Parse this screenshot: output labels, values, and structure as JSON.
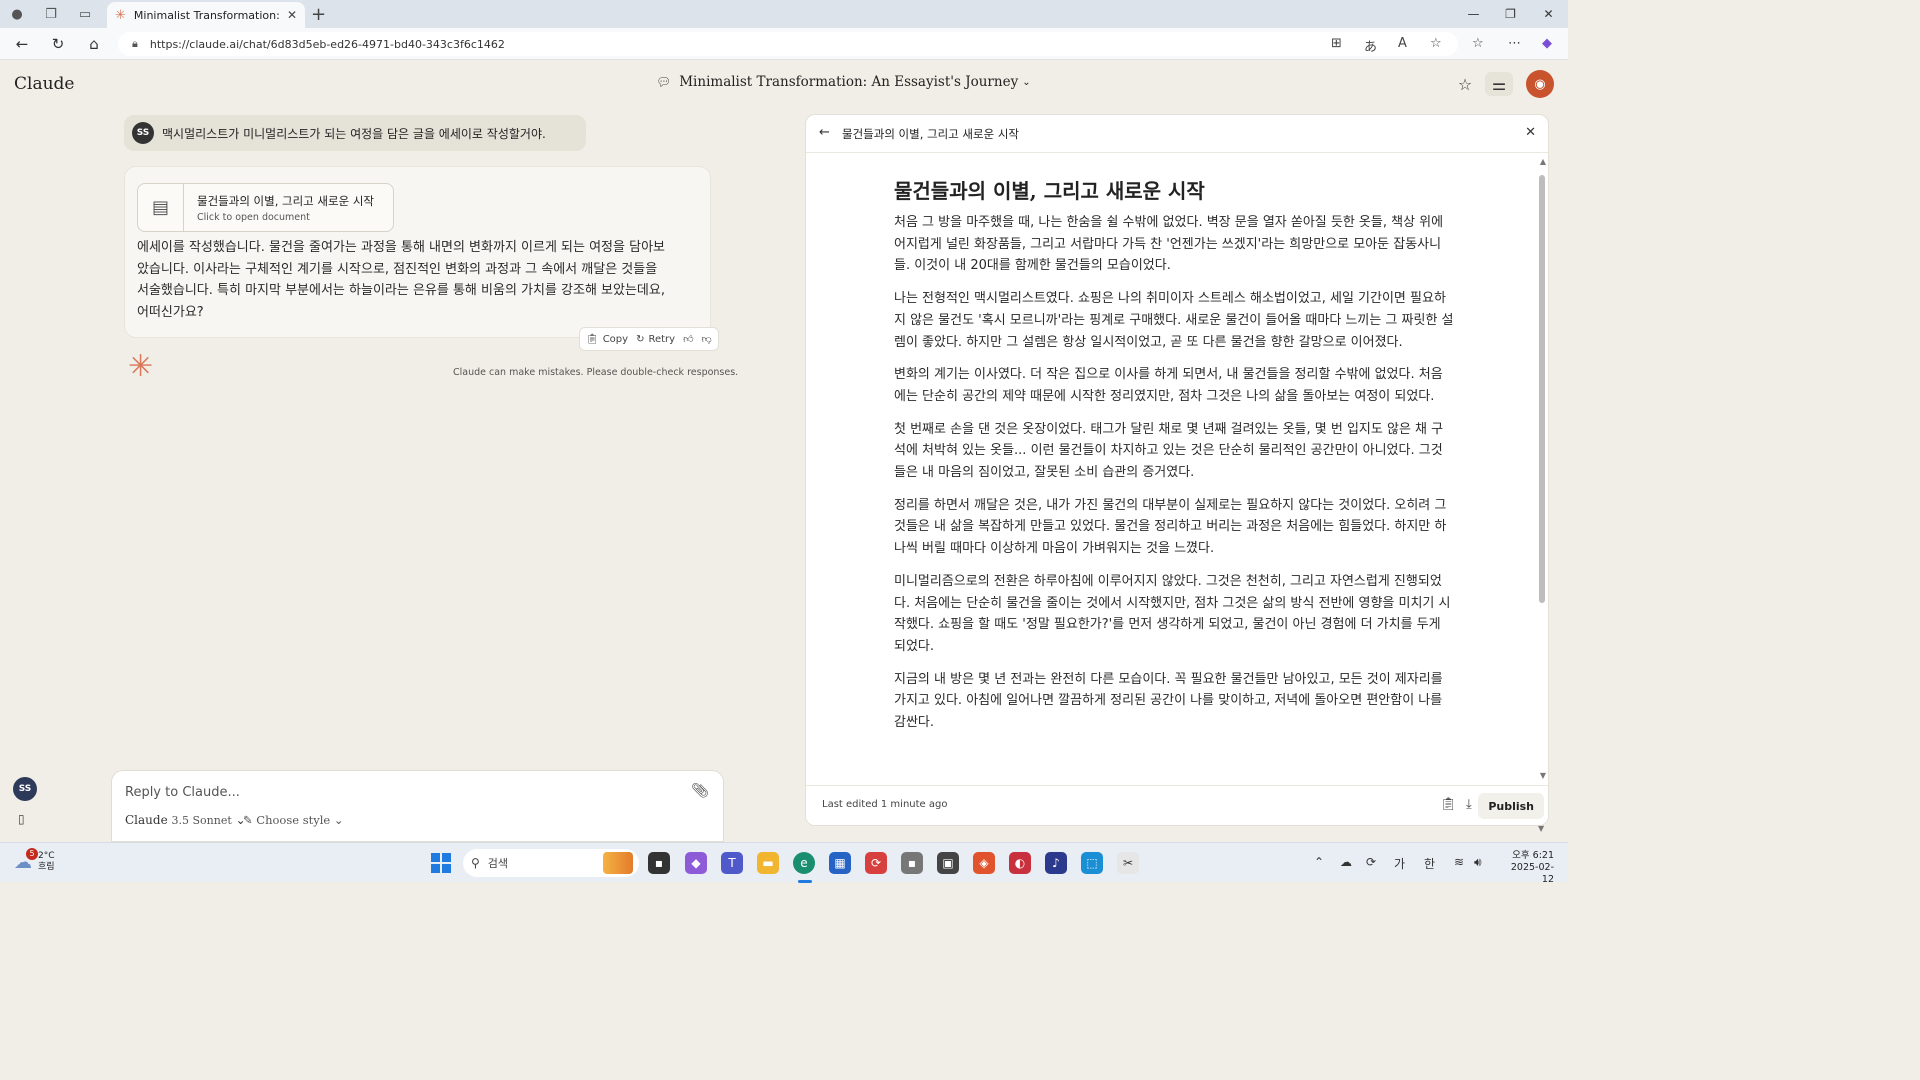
{
  "browser": {
    "tab_title": "Minimalist Transformation: An Ess",
    "url": "https://claude.ai/chat/6d83d5eb-ed26-4971-bd40-343c3f6c1462"
  },
  "header": {
    "logo": "Claude",
    "conversation_title": "Minimalist Transformation: An Essayist's Journey"
  },
  "chat": {
    "user_avatar": "SS",
    "user_message": "맥시멀리스트가 미니멀리스트가 되는 여정을 담은 글을 에세이로 작성할거야.",
    "doc_card_title": "물건들과의 이별, 그리고 새로운 시작",
    "doc_card_sub": "Click to open document",
    "assistant_text": "에세이를 작성했습니다. 물건을 줄여가는 과정을 통해 내면의 변화까지 이르게 되는 여정을 담아보았습니다. 이사라는 구체적인 계기를 시작으로, 점진적인 변화의 과정과 그 속에서 깨달은 것들을 서술했습니다. 특히 마지막 부분에서는 하늘이라는 은유를 통해 비움의 가치를 강조해 보았는데요, 어떠신가요?",
    "copy_label": "Copy",
    "retry_label": "Retry",
    "disclaimer": "Claude can make mistakes. Please double-check responses."
  },
  "input": {
    "placeholder": "Reply to Claude...",
    "model_name": "Claude",
    "model_version": "3.5 Sonnet",
    "style_label": "Choose style"
  },
  "sidebar": {
    "avatar": "SS"
  },
  "panel": {
    "header_title": "물건들과의 이별, 그리고 새로운 시작",
    "doc_title": "물건들과의 이별, 그리고 새로운 시작",
    "paragraphs": [
      "처음 그 방을 마주했을 때, 나는 한숨을 쉴 수밖에 없었다. 벽장 문을 열자 쏟아질 듯한 옷들, 책상 위에 어지럽게 널린 화장품들, 그리고 서랍마다 가득 찬 '언젠가는 쓰겠지'라는 희망만으로 모아둔 잡동사니들. 이것이 내 20대를 함께한 물건들의 모습이었다.",
      "나는 전형적인 맥시멀리스트였다. 쇼핑은 나의 취미이자 스트레스 해소법이었고, 세일 기간이면 필요하지 않은 물건도 '혹시 모르니까'라는 핑계로 구매했다. 새로운 물건이 들어올 때마다 느끼는 그 짜릿한 설렘이 좋았다. 하지만 그 설렘은 항상 일시적이었고, 곧 또 다른 물건을 향한 갈망으로 이어졌다.",
      "변화의 계기는 이사였다. 더 작은 집으로 이사를 하게 되면서, 내 물건들을 정리할 수밖에 없었다. 처음에는 단순히 공간의 제약 때문에 시작한 정리였지만, 점차 그것은 나의 삶을 돌아보는 여정이 되었다.",
      "첫 번째로 손을 댄 것은 옷장이었다. 태그가 달린 채로 몇 년째 걸려있는 옷들, 몇 번 입지도 않은 채 구석에 처박혀 있는 옷들... 이런 물건들이 차지하고 있는 것은 단순히 물리적인 공간만이 아니었다. 그것들은 내 마음의 짐이었고, 잘못된 소비 습관의 증거였다.",
      "정리를 하면서 깨달은 것은, 내가 가진 물건의 대부분이 실제로는 필요하지 않다는 것이었다. 오히려 그것들은 내 삶을 복잡하게 만들고 있었다. 물건을 정리하고 버리는 과정은 처음에는 힘들었다. 하지만 하나씩 버릴 때마다 이상하게 마음이 가벼워지는 것을 느꼈다.",
      "미니멀리즘으로의 전환은 하루아침에 이루어지지 않았다. 그것은 천천히, 그리고 자연스럽게 진행되었다. 처음에는 단순히 물건을 줄이는 것에서 시작했지만, 점차 그것은 삶의 방식 전반에 영향을 미치기 시작했다. 쇼핑을 할 때도 '정말 필요한가?'를 먼저 생각하게 되었고, 물건이 아닌 경험에 더 가치를 두게 되었다.",
      "지금의 내 방은 몇 년 전과는 완전히 다른 모습이다. 꼭 필요한 물건들만 남아있고, 모든 것이 제자리를 가지고 있다. 아침에 일어나면 깔끔하게 정리된 공간이 나를 맞이하고, 저녁에 돌아오면 편안함이 나를 감싼다."
    ],
    "last_edited": "Last edited 1 minute ago",
    "publish_label": "Publish"
  },
  "taskbar": {
    "weather_temp": "2°C",
    "weather_desc": "흐림",
    "weather_badge": "5",
    "search_placeholder": "검색",
    "tray_lang1": "가",
    "tray_lang2": "한",
    "time": "오후 6:21",
    "date": "2025-02-12"
  },
  "colors": {
    "accent": "#d97757",
    "background": "#f0eee6",
    "avatar": "#c8532c"
  }
}
